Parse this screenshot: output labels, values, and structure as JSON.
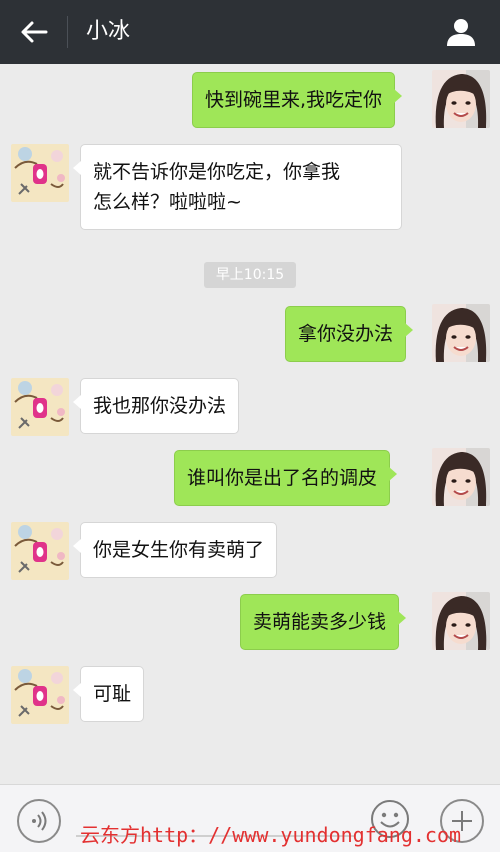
{
  "header": {
    "title": "小冰",
    "back_icon": "arrow-left-icon",
    "profile_icon": "person-icon"
  },
  "messages": [
    {
      "from": "me",
      "text": "快到碗里来,我吃定你"
    },
    {
      "from": "other",
      "lines": [
        "就不告诉你是你吃定，你拿我",
        "怎么样？啦啦啦~"
      ]
    },
    {
      "from": "me",
      "text": "拿你没办法"
    },
    {
      "from": "other",
      "text": "我也那你没办法"
    },
    {
      "from": "me",
      "text": "谁叫你是出了名的调皮"
    },
    {
      "from": "other",
      "text": "你是女生你有卖萌了"
    },
    {
      "from": "me",
      "text": "卖萌能卖多少钱"
    },
    {
      "from": "other",
      "text": "可耻"
    }
  ],
  "timestamp": "早上10:15",
  "bottom": {
    "voice_icon": "voice-icon",
    "emoji_icon": "smiley-icon",
    "plus_icon": "plus-icon"
  },
  "watermark": "云东方http：//www.yundongfang.com",
  "colors": {
    "titlebar": "#2d3136",
    "my_bubble": "#9fe658",
    "other_bubble": "#ffffff",
    "background": "#ebebeb",
    "watermark": "#e33131"
  }
}
